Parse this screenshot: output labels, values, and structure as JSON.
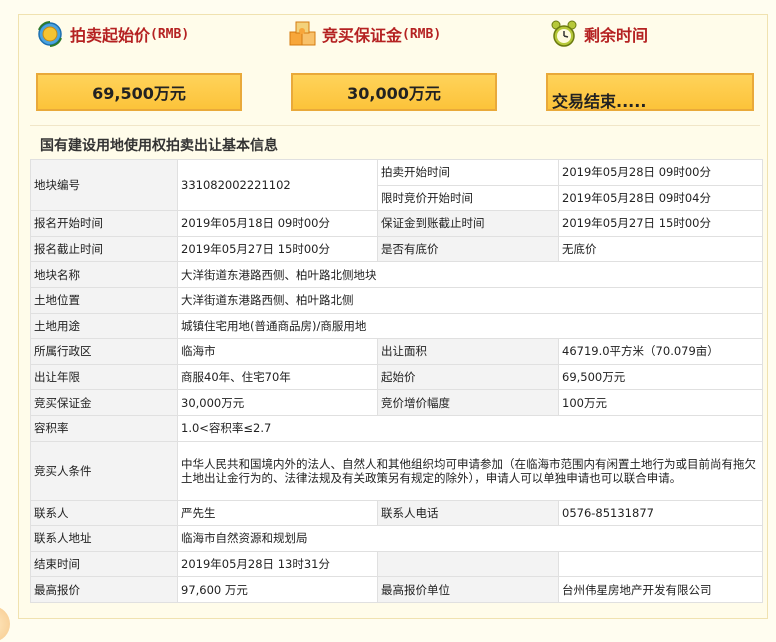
{
  "header": {
    "items": [
      {
        "label": "拍卖起始价",
        "rmb": "(RMB)",
        "icon": "coin-icon"
      },
      {
        "label": "竞买保证金",
        "rmb": "(RMB)",
        "icon": "puzzle-icon"
      },
      {
        "label": "剩余时间",
        "rmb": "",
        "icon": "alarm-clock-icon"
      }
    ],
    "boxes": {
      "start_price": "69,500万元",
      "deposit": "30,000万元",
      "remaining": "交易结束....."
    }
  },
  "section_title": "国有建设用地使用权拍卖出让基本信息",
  "table": {
    "r1": {
      "l1": "地块编号",
      "v1": "331082002221102",
      "l2": "拍卖开始时间",
      "v2": "2019年05月28日 09时00分"
    },
    "r1b": {
      "l2": "限时竞价开始时间",
      "v2": "2019年05月28日 09时04分"
    },
    "r2": {
      "l1": "报名开始时间",
      "v1": "2019年05月18日 09时00分",
      "l2": "保证金到账截止时间",
      "v2": "2019年05月27日 15时00分"
    },
    "r3": {
      "l1": "报名截止时间",
      "v1": "2019年05月27日 15时00分",
      "l2": "是否有底价",
      "v2": "无底价"
    },
    "r4": {
      "l1": "地块名称",
      "v1": "大洋街道东港路西侧、柏叶路北侧地块"
    },
    "r5": {
      "l1": "土地位置",
      "v1": "大洋街道东港路西侧、柏叶路北侧"
    },
    "r6": {
      "l1": "土地用途",
      "v1": "城镇住宅用地(普通商品房)/商服用地"
    },
    "r7": {
      "l1": "所属行政区",
      "v1": "临海市",
      "l2": "出让面积",
      "v2": "46719.0平方米（70.079亩）"
    },
    "r8": {
      "l1": "出让年限",
      "v1": "商服40年、住宅70年",
      "l2": "起始价",
      "v2": "69,500万元"
    },
    "r9": {
      "l1": "竞买保证金",
      "v1": "30,000万元",
      "l2": "竞价增价幅度",
      "v2": "100万元"
    },
    "r10": {
      "l1": "容积率",
      "v1": "1.0<容积率≤2.7"
    },
    "r11": {
      "l1": "竞买人条件",
      "v1": "中华人民共和国境内外的法人、自然人和其他组织均可申请参加（在临海市范围内有闲置土地行为或目前尚有拖欠土地出让金行为的、法律法规及有关政策另有规定的除外），申请人可以单独申请也可以联合申请。"
    },
    "r12": {
      "l1": "联系人",
      "v1": "严先生",
      "l2": "联系人电话",
      "v2": "0576-85131877"
    },
    "r13": {
      "l1": "联系人地址",
      "v1": "临海市自然资源和规划局"
    },
    "r14": {
      "l1": "结束时间",
      "v1": "2019年05月28日 13时31分",
      "l2": "",
      "v2": ""
    },
    "r15": {
      "l1": "最高报价",
      "v1": "97,600 万元",
      "l2": "最高报价单位",
      "v2": "台州伟星房地产开发有限公司"
    }
  },
  "colors": {
    "accent": "#b52222",
    "box_fill": "#fcc33a",
    "box_border": "#e9a93a"
  }
}
